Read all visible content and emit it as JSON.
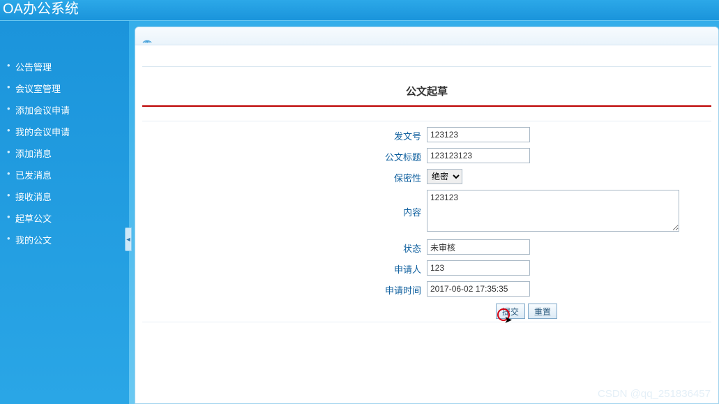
{
  "header": {
    "title": "OA办公系统"
  },
  "sidebar": {
    "items": [
      {
        "label": "公告管理"
      },
      {
        "label": "会议室管理"
      },
      {
        "label": "添加会议申请"
      },
      {
        "label": "我的会议申请"
      },
      {
        "label": "添加消息"
      },
      {
        "label": "已发消息"
      },
      {
        "label": "接收消息"
      },
      {
        "label": "起草公文"
      },
      {
        "label": "我的公文"
      }
    ]
  },
  "page": {
    "title": "公文起草",
    "form": {
      "doc_number": {
        "label": "发文号",
        "value": "123123"
      },
      "doc_title": {
        "label": "公文标题",
        "value": "123123123"
      },
      "secrecy": {
        "label": "保密性",
        "value": "绝密",
        "options": [
          "绝密"
        ]
      },
      "content": {
        "label": "内容",
        "value": "123123"
      },
      "status": {
        "label": "状态",
        "value": "未审核"
      },
      "applicant": {
        "label": "申请人",
        "value": "123"
      },
      "apply_time": {
        "label": "申请时间",
        "value": "2017-06-02 17:35:35"
      }
    },
    "buttons": {
      "submit": "提交",
      "reset": "重置"
    }
  },
  "watermark": "CSDN @qq_251836457"
}
